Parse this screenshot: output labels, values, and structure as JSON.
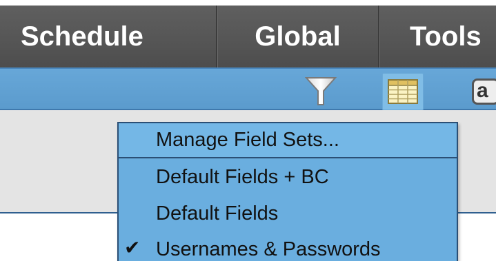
{
  "nav": {
    "tabs": [
      {
        "label": "Schedule"
      },
      {
        "label": "Global"
      },
      {
        "label": "Tools"
      }
    ]
  },
  "toolbar": {
    "filter_icon": "filter-icon",
    "grid_icon": "table-grid-icon",
    "cut_icon_label": "a"
  },
  "dropdown": {
    "items": [
      {
        "label": "Manage Field Sets...",
        "checked": false
      },
      {
        "label": "Default Fields + BC",
        "checked": false
      },
      {
        "label": "Default Fields",
        "checked": false
      },
      {
        "label": "Usernames & Passwords",
        "checked": true
      }
    ],
    "check_mark": "✔"
  },
  "colors": {
    "nav_bg": "#555555",
    "toolbar_bg": "#5b9bcd",
    "menu_bg": "#6aaedf",
    "menu_border": "#2b4f75"
  }
}
